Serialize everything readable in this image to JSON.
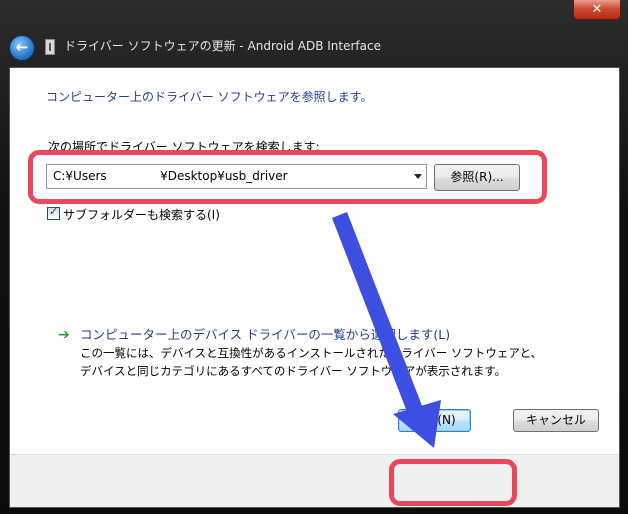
{
  "window": {
    "title": "ドライバー ソフトウェアの更新 - Android ADB Interface",
    "close_glyph": "✕"
  },
  "nav": {
    "back_glyph": "←"
  },
  "content": {
    "heading": "コンピューター上のドライバー ソフトウェアを参照します。",
    "search_label": "次の場所でドライバー ソフトウェアを検索します:",
    "path_value": "C:¥Users              ¥Desktop¥usb_driver",
    "browse_label": "参照(R)...",
    "subfolder_label": "サブフォルダーも検索する(I)",
    "subfolder_checked": true,
    "pick_title": "コンピューター上のデバイス ドライバーの一覧から選択します(L)",
    "pick_desc": "この一覧には、デバイスと互換性があるインストールされたドライバー ソフトウェアと、デバイスと同じカテゴリにあるすべてのドライバー ソフトウェアが表示されます。"
  },
  "footer": {
    "next_label": "次へ(N)",
    "cancel_label": "キャンセル"
  },
  "annotations": {
    "highlight_color": "#e8485a",
    "arrow_color": "#3c4fe0"
  }
}
